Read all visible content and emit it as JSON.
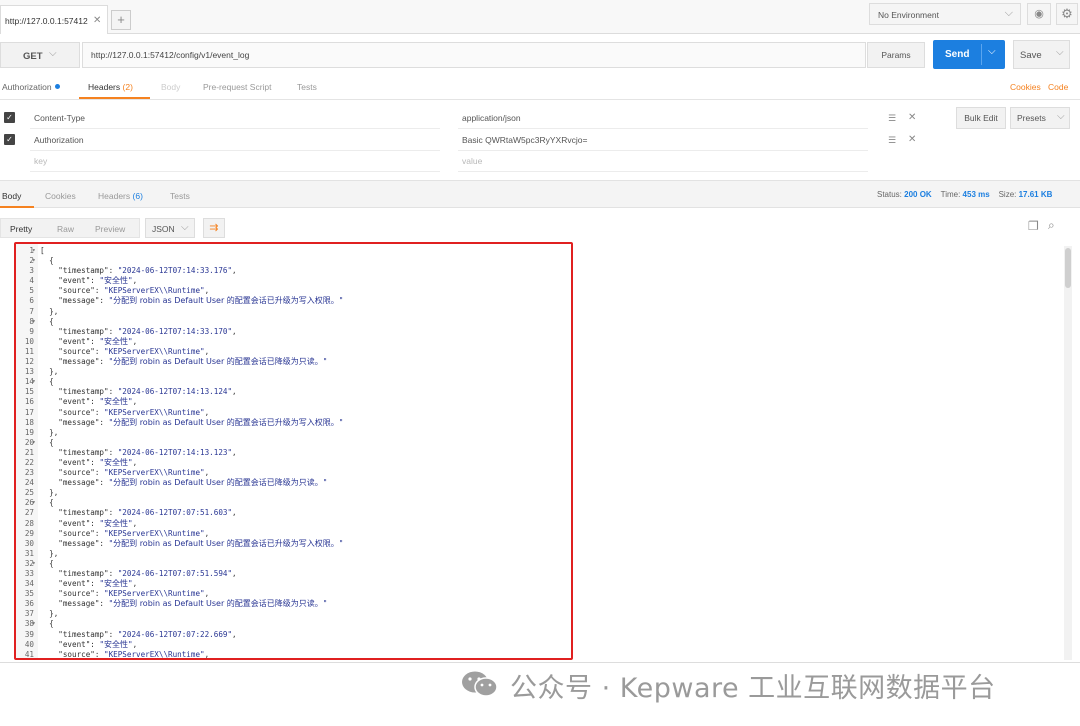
{
  "tabbar": {
    "active_tab": "http://127.0.0.1:57412",
    "environment": "No Environment"
  },
  "request": {
    "method": "GET",
    "url": "http://127.0.0.1:57412/config/v1/event_log",
    "params_label": "Params",
    "send_label": "Send",
    "save_label": "Save"
  },
  "request_tabs": {
    "authorization": "Authorization",
    "headers": "Headers",
    "headers_count": "(2)",
    "body": "Body",
    "prerequest": "Pre-request Script",
    "tests": "Tests",
    "cookies": "Cookies",
    "code": "Code"
  },
  "headers": {
    "rows": [
      {
        "key": "Content-Type",
        "value": "application/json"
      },
      {
        "key": "Authorization",
        "value": "Basic QWRtaW5pc3RyYXRvcjo="
      }
    ],
    "key_placeholder": "key",
    "value_placeholder": "value",
    "bulk_edit": "Bulk Edit",
    "presets": "Presets"
  },
  "response_tabs": {
    "body": "Body",
    "cookies": "Cookies",
    "headers": "Headers",
    "headers_count": "(6)",
    "tests": "Tests"
  },
  "status": {
    "status_label": "Status:",
    "status_value": "200 OK",
    "time_label": "Time:",
    "time_value": "453 ms",
    "size_label": "Size:",
    "size_value": "17.61 KB"
  },
  "format": {
    "pretty": "Pretty",
    "raw": "Raw",
    "preview": "Preview",
    "type": "JSON"
  },
  "response_entries": [
    {
      "timestamp": "2024-06-12T07:14:33.176",
      "event": "安全性",
      "source": "KEPServerEX\\\\Runtime",
      "message": "分配到 robin as Default User 的配置会话已升级为写入权限。"
    },
    {
      "timestamp": "2024-06-12T07:14:33.170",
      "event": "安全性",
      "source": "KEPServerEX\\\\Runtime",
      "message": "分配到 robin as Default User 的配置会话已降级为只读。"
    },
    {
      "timestamp": "2024-06-12T07:14:13.124",
      "event": "安全性",
      "source": "KEPServerEX\\\\Runtime",
      "message": "分配到 robin as Default User 的配置会话已升级为写入权限。"
    },
    {
      "timestamp": "2024-06-12T07:14:13.123",
      "event": "安全性",
      "source": "KEPServerEX\\\\Runtime",
      "message": "分配到 robin as Default User 的配置会话已降级为只读。"
    },
    {
      "timestamp": "2024-06-12T07:07:51.603",
      "event": "安全性",
      "source": "KEPServerEX\\\\Runtime",
      "message": "分配到 robin as Default User 的配置会话已升级为写入权限。"
    },
    {
      "timestamp": "2024-06-12T07:07:51.594",
      "event": "安全性",
      "source": "KEPServerEX\\\\Runtime",
      "message": "分配到 robin as Default User 的配置会话已降级为只读。"
    },
    {
      "timestamp": "2024-06-12T07:07:22.669",
      "event": "安全性",
      "source": "KEPServerEX\\\\Runtime",
      "message": ""
    }
  ],
  "watermark": "公众号 · Kepware 工业互联网数据平台"
}
